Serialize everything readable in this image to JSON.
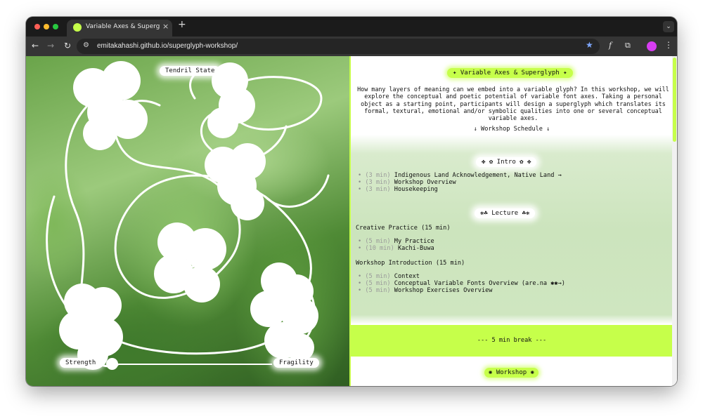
{
  "browser": {
    "tab_title": "Variable Axes & Superglyph W",
    "tab_close": "×",
    "new_tab": "+",
    "tab_menu": "⌄",
    "nav_back": "←",
    "nav_forward": "→",
    "nav_reload": "↻",
    "site_info_icon": "⚙",
    "url": "emitakahashi.github.io/superglyph-workshop/",
    "bookmark_star": "★",
    "font_ext": "f",
    "extensions": "⧉",
    "menu": "⋮",
    "accent": "#c6ff4a"
  },
  "left": {
    "tendril_label": "Tendril State",
    "slider_left_label": "Strength",
    "slider_right_label": "Fragility",
    "slider_value_fraction": 0.0
  },
  "right": {
    "title": "✦ Variable Axes & Superglyph ✦",
    "intro": "How many layers of meaning can we embed into a variable glyph? In this workshop, we will explore the conceptual and poetic potential of variable font axes. Taking a personal object as a starting point, participants will design a superglyph which translates its formal, textural, emotional and/or symbolic qualities into one or several conceptual variable axes.",
    "schedule_link": "↓ Workshop Schedule ↓",
    "intro_section": {
      "title": "✤ ✿ Intro ✿ ✤",
      "items": [
        {
          "duration": "(3 min)",
          "label": "Indigenous Land Acknowledgement, Native Land →"
        },
        {
          "duration": "(3 min)",
          "label": "Workshop Overview"
        },
        {
          "duration": "(3 min)",
          "label": "Housekeeping"
        }
      ]
    },
    "lecture_section": {
      "title": "❋☘ Lecture ☘❋",
      "creative_practice_heading": "Creative Practice (15 min)",
      "creative_items": [
        {
          "duration": "(5 min)",
          "label": "My Practice"
        },
        {
          "duration": "(10 min)",
          "label": "Kachi-Buwa"
        }
      ],
      "workshop_intro_heading": "Workshop Introduction (15 min)",
      "workshop_intro_items": [
        {
          "duration": "(5 min)",
          "label": "Context"
        },
        {
          "duration": "(5 min)",
          "label": "Conceptual Variable Fonts Overview (are.na ✱✱→)"
        },
        {
          "duration": "(5 min)",
          "label": "Workshop Exercises Overview"
        }
      ]
    },
    "break_text": "--- 5 min break ---",
    "workshop_title": "✺ Workshop ✺"
  }
}
